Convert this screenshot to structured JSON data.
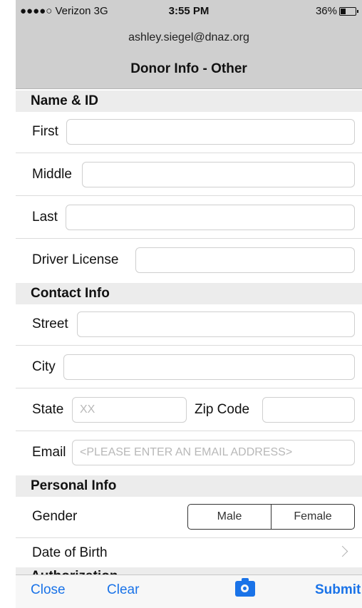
{
  "status_bar": {
    "signal": "●●●●○ Verizon  3G",
    "time": "3:55 PM",
    "battery": "36%",
    "battery_level": 0.36
  },
  "header": {
    "email": "ashley.siegel@dnaz.org",
    "title": "Donor Info - Other"
  },
  "sections": {
    "name_id": "Name & ID",
    "contact": "Contact Info",
    "personal": "Personal Info",
    "authorization": "Authorization"
  },
  "fields": {
    "first": {
      "label": "First",
      "value": ""
    },
    "middle": {
      "label": "Middle",
      "value": ""
    },
    "last": {
      "label": "Last",
      "value": ""
    },
    "driver_license": {
      "label": "Driver License",
      "value": ""
    },
    "street": {
      "label": "Street",
      "value": ""
    },
    "city": {
      "label": "City",
      "value": ""
    },
    "state": {
      "label": "State",
      "placeholder": "XX"
    },
    "zip": {
      "label": "Zip Code",
      "value": ""
    },
    "email": {
      "label": "Email",
      "placeholder": "<PLEASE ENTER AN EMAIL ADDRESS>"
    }
  },
  "gender": {
    "label": "Gender",
    "options": [
      "Male",
      "Female"
    ]
  },
  "dob": {
    "label": "Date of Birth"
  },
  "toolbar": {
    "close": "Close",
    "clear": "Clear",
    "submit": "Submit",
    "camera_icon": "camera-icon"
  },
  "colors": {
    "accent": "#1a73e8",
    "header_bg": "#cfcfcf",
    "section_bg": "#ececec"
  }
}
